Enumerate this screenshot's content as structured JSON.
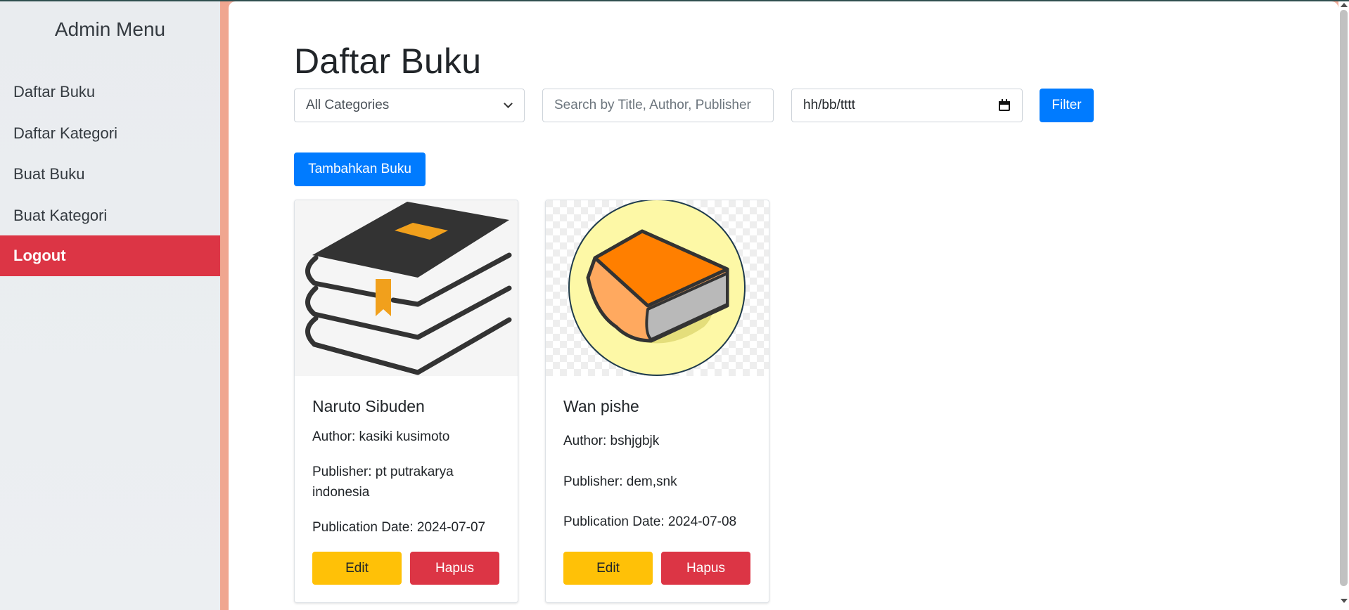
{
  "sidebar": {
    "title": "Admin Menu",
    "items": [
      {
        "label": "Daftar Buku"
      },
      {
        "label": "Daftar Kategori"
      },
      {
        "label": "Buat Buku"
      },
      {
        "label": "Buat Kategori"
      },
      {
        "label": "Logout"
      }
    ]
  },
  "main": {
    "title": "Daftar Buku",
    "filters": {
      "category_selected": "All Categories",
      "search_placeholder": "Search by Title, Author, Publisher",
      "date_value": "hh/bb/tttt",
      "filter_label": "Filter"
    },
    "add_button_label": "Tambahkan Buku",
    "books": [
      {
        "title": "Naruto Sibuden",
        "author": "Author: kasiki kusimoto",
        "publisher": "Publisher: pt putrakarya indonesia",
        "publication_date": "Publication Date: 2024-07-07",
        "edit_label": "Edit",
        "delete_label": "Hapus",
        "cover_icon": "stacked-books-icon"
      },
      {
        "title": "Wan pishe",
        "author": "Author: bshjgbjk",
        "publisher": "Publisher: dem,snk",
        "publication_date": "Publication Date: 2024-07-08",
        "edit_label": "Edit",
        "delete_label": "Hapus",
        "cover_icon": "orange-book-icon"
      }
    ]
  },
  "colors": {
    "primary": "#007bff",
    "danger": "#dc3545",
    "warning": "#ffc107",
    "sidebar_bg": "#e9ecef",
    "accent_stripe": "#f0a690"
  }
}
